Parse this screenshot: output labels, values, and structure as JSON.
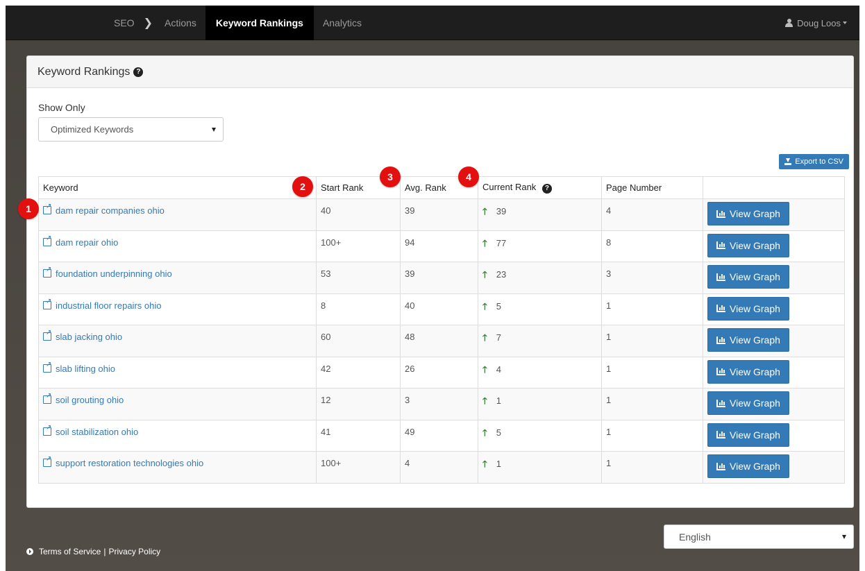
{
  "nav": {
    "items": [
      {
        "label": "SEO"
      },
      {
        "label": "Actions"
      },
      {
        "label": "Keyword Rankings"
      },
      {
        "label": "Analytics"
      }
    ],
    "user_name": "Doug Loos"
  },
  "panel": {
    "title": "Keyword Rankings",
    "help_glyph": "?",
    "show_only_label": "Show Only",
    "show_only_value": "Optimized Keywords",
    "export_label": "Export to CSV"
  },
  "table": {
    "headers": [
      "Keyword",
      "Start Rank",
      "Avg. Rank",
      "Current Rank",
      "Page Number",
      ""
    ],
    "button_label": "View Graph",
    "rows": [
      {
        "keyword": "dam repair companies ohio",
        "start": "40",
        "avg": "39",
        "current": "39",
        "page": "4"
      },
      {
        "keyword": "dam repair ohio",
        "start": "100+",
        "avg": "94",
        "current": "77",
        "page": "8"
      },
      {
        "keyword": "foundation underpinning ohio",
        "start": "53",
        "avg": "39",
        "current": "23",
        "page": "3"
      },
      {
        "keyword": "industrial floor repairs ohio",
        "start": "8",
        "avg": "40",
        "current": "5",
        "page": "1"
      },
      {
        "keyword": "slab jacking ohio",
        "start": "60",
        "avg": "48",
        "current": "7",
        "page": "1"
      },
      {
        "keyword": "slab lifting ohio",
        "start": "42",
        "avg": "26",
        "current": "4",
        "page": "1"
      },
      {
        "keyword": "soil grouting ohio",
        "start": "12",
        "avg": "3",
        "current": "1",
        "page": "1"
      },
      {
        "keyword": "soil stabilization ohio",
        "start": "41",
        "avg": "49",
        "current": "5",
        "page": "1"
      },
      {
        "keyword": "support restoration technologies ohio",
        "start": "100+",
        "avg": "4",
        "current": "1",
        "page": "1"
      }
    ]
  },
  "badges": [
    "1",
    "2",
    "3",
    "4"
  ],
  "footer": {
    "language": "English",
    "terms": "Terms of Service",
    "separator": "|",
    "privacy": "Privacy Policy"
  },
  "colors": {
    "accent": "#337ab7",
    "badge": "#e31010",
    "up_arrow": "#3b7d3b",
    "navbar": "#1e1e1e"
  }
}
